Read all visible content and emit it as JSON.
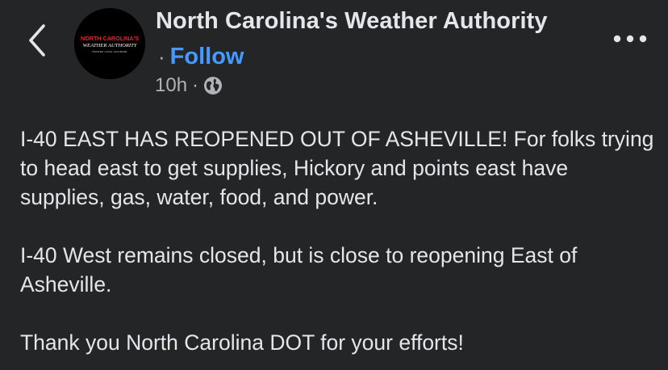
{
  "header": {
    "back_icon": "chevron-left-icon",
    "page_name": "North Carolina's Weather Authority",
    "follow_separator": "·",
    "follow_label": "Follow",
    "timestamp": "10h",
    "meta_separator": "·",
    "audience_icon": "globe-icon",
    "more_icon": "more-horizontal-icon"
  },
  "avatar": {
    "logo_line1": "NORTH CAROLINA'S",
    "logo_line2": "WEATHER AUTHORITY",
    "logo_tagline": "TRUSTED. LOCAL. ACCURATE."
  },
  "post": {
    "paragraphs": [
      "I-40 EAST HAS REOPENED OUT OF ASHEVILLE! For folks trying to head east to get supplies, Hickory and points east have supplies, gas, water, food, and power.",
      "I-40 West remains closed, but is close to reopening East of Asheville.",
      "Thank you North Carolina DOT for your efforts!"
    ]
  },
  "colors": {
    "background": "#242526",
    "text": "#e4e6eb",
    "secondary_text": "#b0b3b8",
    "link": "#4599ff",
    "logo_accent": "#e0262b"
  }
}
